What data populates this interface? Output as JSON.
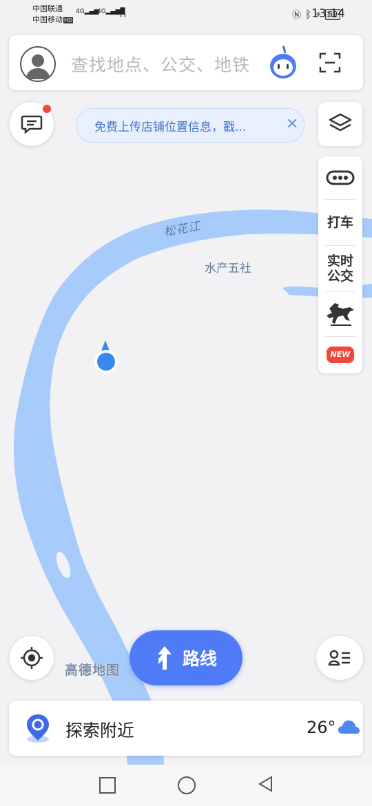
{
  "status_bar": {
    "carrier_1": "中国联通",
    "carrier_2": "中国移动",
    "hd_badge": "HD",
    "net_1": "4G",
    "net_2": "4G",
    "battery": "69",
    "time": "13:14"
  },
  "search": {
    "placeholder": "查找地点、公交、地铁"
  },
  "notice": {
    "text": "免费上传店铺位置信息，戳..."
  },
  "map": {
    "river_label": "松花江",
    "place_label": "水产五社",
    "brand_watermark": "高德地图",
    "water_color": "#a7cbfa",
    "land_color": "#f2f2f4"
  },
  "side_tools": {
    "taxi": "打车",
    "bus_line1": "实时",
    "bus_line2": "公交",
    "new_badge": "NEW"
  },
  "route_button": {
    "label": "路线"
  },
  "explore": {
    "label": "探索附近",
    "temperature": "26°"
  },
  "colors": {
    "accent": "#4f7cf6",
    "badge_red": "#f2483c",
    "location_blue": "#3a87f3"
  }
}
